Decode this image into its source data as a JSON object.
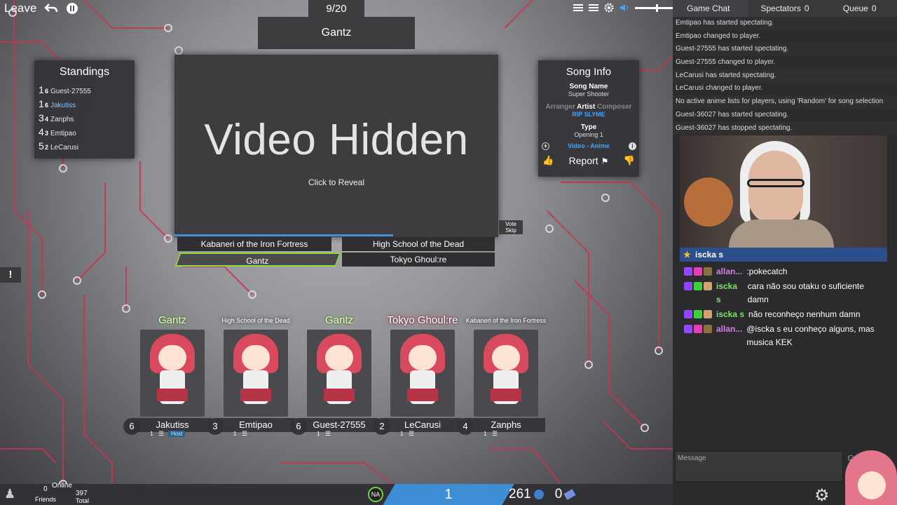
{
  "topbar": {
    "leave_label": "Leave",
    "song_counter": "9/20",
    "answer_display": "Gantz"
  },
  "standings": {
    "title": "Standings",
    "rows": [
      {
        "rank": "1",
        "score": "6",
        "name": "Guest-27555",
        "color": "#e6e6e6"
      },
      {
        "rank": "1",
        "score": "6",
        "name": "Jakutiss",
        "color": "#7fc8ff"
      },
      {
        "rank": "3",
        "score": "4",
        "name": "Zanphs",
        "color": "#e6e6e6"
      },
      {
        "rank": "4",
        "score": "3",
        "name": "Emtipao",
        "color": "#e6e6e6"
      },
      {
        "rank": "5",
        "score": "2",
        "name": "LeCarusi",
        "color": "#e6e6e6"
      }
    ]
  },
  "video": {
    "hidden_text": "Video Hidden",
    "reveal_text": "Click to Reveal",
    "vote_skip": "Vote Skip"
  },
  "song_info": {
    "title": "Song Info",
    "song_name_label": "Song Name",
    "song_name": "Super Shooter",
    "arranger_label": "Arranger",
    "artist_label": "Artist",
    "composer_label": "Composer",
    "artist_value": "RIP SLYME",
    "type_label": "Type",
    "type_value": "Opening 1",
    "video_link": "Video",
    "separator": "-",
    "anime_link": "Anime",
    "report_label": "Report"
  },
  "answers": {
    "row1_left": "Kabaneri of the Iron Fortress",
    "row1_right": "High School of the Dead",
    "row2_left": "Gantz",
    "row2_right": "Tokyo Ghoul:re"
  },
  "alert_label": "!",
  "players": [
    {
      "answer": "Gantz",
      "answer_style": "green",
      "score": "6",
      "name": "Jakutiss",
      "level": "1",
      "host": "Host"
    },
    {
      "answer": "High School of the Dead",
      "answer_style": "small",
      "score": "3",
      "name": "Emtipao",
      "level": "1",
      "host": ""
    },
    {
      "answer": "Gantz",
      "answer_style": "green",
      "score": "6",
      "name": "Guest-27555",
      "level": "1",
      "host": ""
    },
    {
      "answer": "Tokyo Ghoul:re",
      "answer_style": "red",
      "score": "2",
      "name": "LeCarusi",
      "level": "1",
      "host": ""
    },
    {
      "answer": "Kabaneri of the Iron Fortress",
      "answer_style": "small",
      "score": "4",
      "name": "Zanphs",
      "level": "1",
      "host": ""
    }
  ],
  "bottom": {
    "friends_count": "0",
    "friends_label": "Friends",
    "online_label": "Online",
    "total_count": "397",
    "total_label": "Total",
    "region": "NA",
    "level": "1",
    "currency1": "261",
    "currency2": "0"
  },
  "chat": {
    "tabs": [
      {
        "label": "Game Chat",
        "count": ""
      },
      {
        "label": "Spectators",
        "count": "0"
      },
      {
        "label": "Queue",
        "count": "0"
      }
    ],
    "messages": [
      "Emtipao has started spectating.",
      "Emtipao changed to player.",
      "Guest-27555 has started spectating.",
      "Guest-27555 changed to player.",
      "LeCarusi has started spectating.",
      "LeCarusi changed to player.",
      "No active anime lists for players, using 'Random' for song selection",
      "Guest-36027 has started spectating.",
      "Guest-36027 has stopped spectating."
    ],
    "input_placeholder": "Message"
  },
  "stream": {
    "streamer": "iscka s"
  },
  "twitch": {
    "messages": [
      {
        "user": "allan...",
        "text": ":pokecatch",
        "color": "#d37ee8"
      },
      {
        "user": "iscka s",
        "text": "cara não sou otaku o suficiente damn",
        "color": "#7fe06a"
      },
      {
        "user": "iscka s",
        "text": "não reconheço nenhum damn",
        "color": "#7fe06a"
      },
      {
        "user": "allan...",
        "text": "@iscka s eu conheço alguns, mas musica KEK",
        "color": "#d37ee8"
      }
    ]
  },
  "colors": {
    "accent_blue": "#3ea6ff",
    "correct_green": "#8ed84a",
    "circuit_red": "#d43a52"
  }
}
